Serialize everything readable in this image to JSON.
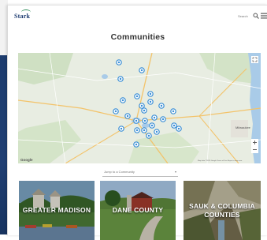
{
  "header": {
    "logo_text": "Stark",
    "search_label": "Search",
    "icons": [
      "search-icon",
      "menu-icon"
    ]
  },
  "page": {
    "title": "Communities"
  },
  "map": {
    "attribution_left": "Google",
    "attribution_right": "Map data ©2020 Google  Terms of Use  Report a map error",
    "city_label": "Milwaukee",
    "controls": [
      "fullscreen-icon",
      "zoom-in",
      "zoom-out"
    ],
    "pin_color": "#3a8ed6"
  },
  "filter": {
    "dropdown_label": "Jump to a Community"
  },
  "cards": [
    {
      "label": "GREATER MADISON"
    },
    {
      "label": "DANE COUNTY"
    },
    {
      "label": "SAUK & COLUMBIA COUNTIES"
    }
  ],
  "colors": {
    "brand_navy": "#1c3b70",
    "brand_green": "#2c8a57",
    "backdrop_blue": "#1d3c6e"
  }
}
